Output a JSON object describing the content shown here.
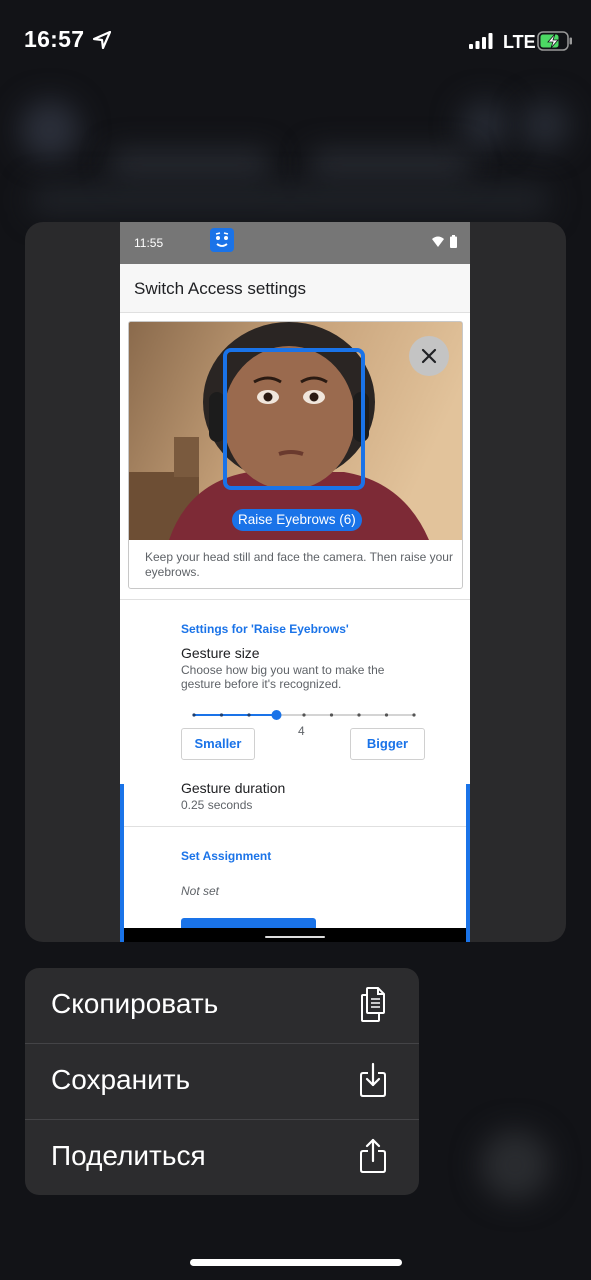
{
  "status_bar": {
    "time": "16:57",
    "network": "LTE",
    "icons": [
      "location-arrow-icon",
      "cellular-signal-icon",
      "battery-charging-icon"
    ]
  },
  "preview": {
    "android_status": {
      "time": "11:55",
      "icons": [
        "switch-access-face-icon",
        "wifi-icon",
        "battery-icon"
      ]
    },
    "app_title": "Switch Access settings",
    "camera": {
      "gesture_badge": "Raise Eyebrows (6)",
      "instruction": "Keep your head still and face the camera. Then raise your eyebrows.",
      "close_icon": "close-icon"
    },
    "settings_section": "Settings for 'Raise Eyebrows'",
    "gesture_size": {
      "title": "Gesture size",
      "description": "Choose how big you want to make the gesture before it's recognized.",
      "value": "4",
      "max": 9,
      "smaller_label": "Smaller",
      "bigger_label": "Bigger"
    },
    "gesture_duration": {
      "title": "Gesture duration",
      "value": "0.25 seconds"
    },
    "set_assignment": {
      "title": "Set Assignment",
      "value": "Not set"
    }
  },
  "menu": {
    "items": [
      {
        "label": "Скопировать",
        "icon": "copy-icon"
      },
      {
        "label": "Сохранить",
        "icon": "save-icon"
      },
      {
        "label": "Поделиться",
        "icon": "share-icon"
      }
    ]
  },
  "colors": {
    "accent": "#1a73e8",
    "menu_bg": "#2c2c2e",
    "card_bg": "#2a2a2c",
    "battery_green": "#4cd964"
  }
}
